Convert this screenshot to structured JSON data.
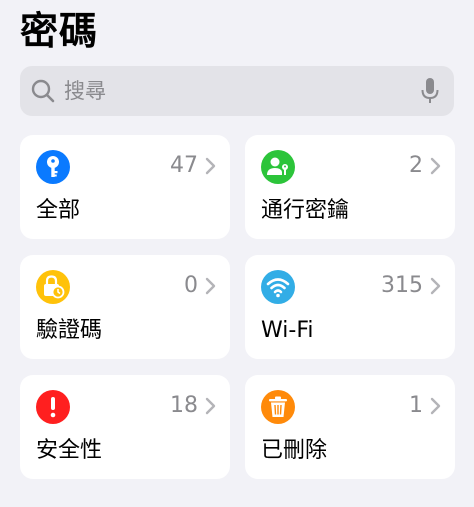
{
  "header": {
    "title": "密碼"
  },
  "search": {
    "placeholder": "搜尋",
    "icon": "magnifying-glass-icon",
    "mic_icon": "microphone-icon"
  },
  "categories": [
    {
      "label": "全部",
      "count": "47",
      "icon": "key-icon",
      "color": "#0A7AFF"
    },
    {
      "label": "通行密鑰",
      "count": "2",
      "icon": "person-key-icon",
      "color": "#2CC43A"
    },
    {
      "label": "驗證碼",
      "count": "0",
      "icon": "lock-clock-icon",
      "color": "#FFC20A"
    },
    {
      "label": "Wi-Fi",
      "count": "315",
      "icon": "wifi-icon",
      "color": "#32ADE6"
    },
    {
      "label": "安全性",
      "count": "18",
      "icon": "exclamation-icon",
      "color": "#FF1F1F"
    },
    {
      "label": "已刪除",
      "count": "1",
      "icon": "trash-icon",
      "color": "#FF8A0A"
    }
  ]
}
